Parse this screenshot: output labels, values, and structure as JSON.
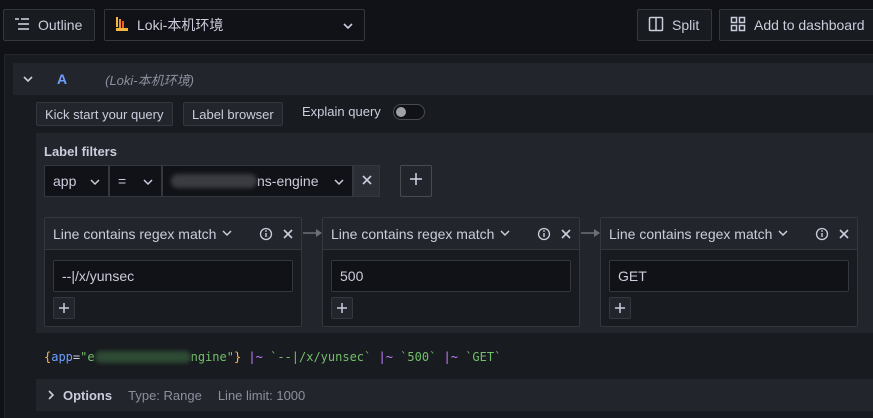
{
  "toolbar": {
    "outline_label": "Outline",
    "datasource_name": "Loki-本机环境",
    "split_label": "Split",
    "add_dashboard_label": "Add to dashboard"
  },
  "query": {
    "ref_id": "A",
    "datasource_hint": "(Loki-本机环境)",
    "kick_start_label": "Kick start your query",
    "label_browser_label": "Label browser",
    "explain_label": "Explain query",
    "explain_enabled": false
  },
  "label_filters": {
    "title": "Label filters",
    "label": "app",
    "operator": "=",
    "value_suffix": "ns-engine"
  },
  "operations": [
    {
      "name": "Line contains regex match",
      "value": "--|/x/yunsec"
    },
    {
      "name": "Line contains regex match",
      "value": "500"
    },
    {
      "name": "Line contains regex match",
      "value": "GET"
    }
  ],
  "preview": {
    "open_brace": "{",
    "key": "app",
    "equals": "=",
    "quote_open": "\"e",
    "value_tail": "ngine\"",
    "close_brace": "}",
    "pipe1": " |~ ",
    "arg1": "`--|/x/yunsec`",
    "pipe2": " |~ ",
    "arg2": "`500`",
    "pipe3": " |~ ",
    "arg3": "`GET`"
  },
  "options": {
    "title": "Options",
    "type_text": "Type: Range",
    "limit_text": "Line limit: 1000"
  },
  "colors": {
    "background": "#111217",
    "panel": "#181b1f",
    "accent_blue": "#6e9fff",
    "string_green": "#73bf69",
    "operator_purple": "#c47eff",
    "brace_orange": "#ffb357"
  }
}
